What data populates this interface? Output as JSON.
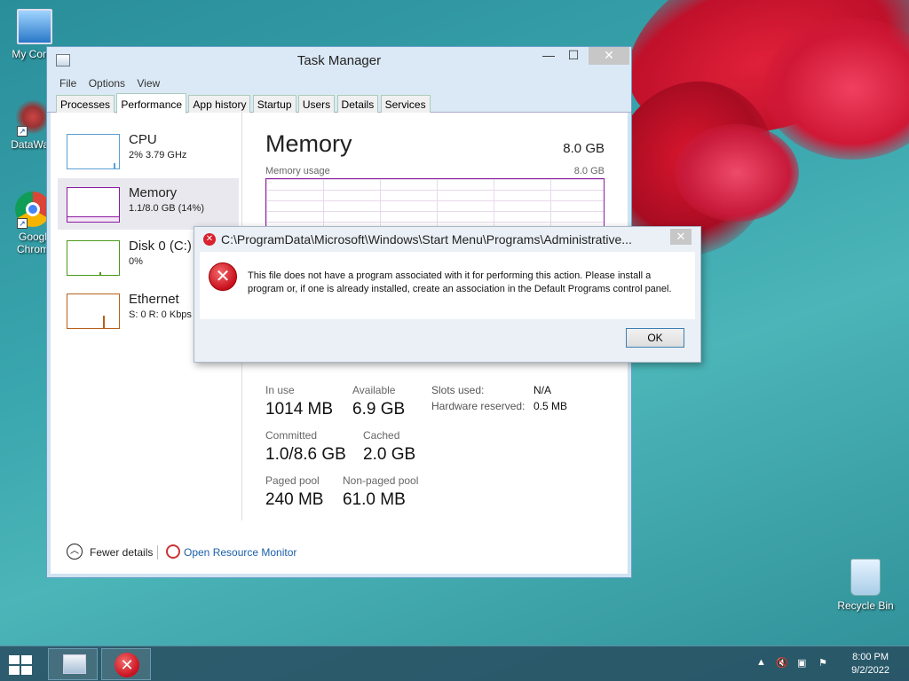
{
  "desktop": {
    "icons": [
      {
        "label": "My Comp"
      },
      {
        "label": "DataWag"
      },
      {
        "label": "Googl Chrom"
      },
      {
        "label": "Recycle Bin"
      }
    ]
  },
  "task_manager": {
    "title": "Task Manager",
    "menu": [
      "File",
      "Options",
      "View"
    ],
    "tabs": [
      "Processes",
      "Performance",
      "App history",
      "Startup",
      "Users",
      "Details",
      "Services"
    ],
    "active_tab": "Performance",
    "sidebar": [
      {
        "name": "CPU",
        "sub": "2%  3.79 GHz"
      },
      {
        "name": "Memory",
        "sub": "1.1/8.0 GB (14%)"
      },
      {
        "name": "Disk 0 (C:)",
        "sub": "0%"
      },
      {
        "name": "Ethernet",
        "sub": "S: 0  R: 0 Kbps"
      }
    ],
    "memory": {
      "title": "Memory",
      "total": "8.0 GB",
      "usage_label": "Memory usage",
      "usage_max": "8.0 GB",
      "stats": {
        "in_use_label": "In use",
        "in_use": "1014 MB",
        "available_label": "Available",
        "available": "6.9 GB",
        "committed_label": "Committed",
        "committed": "1.0/8.6 GB",
        "cached_label": "Cached",
        "cached": "2.0 GB",
        "paged_label": "Paged pool",
        "paged": "240 MB",
        "nonpaged_label": "Non-paged pool",
        "nonpaged": "61.0 MB",
        "slots_label": "Slots used:",
        "slots": "N/A",
        "hw_label": "Hardware reserved:",
        "hw": "0.5 MB"
      }
    },
    "footer": {
      "fewer_details": "Fewer details",
      "open_resource_monitor": "Open Resource Monitor"
    }
  },
  "dialog": {
    "title": "C:\\ProgramData\\Microsoft\\Windows\\Start Menu\\Programs\\Administrative...",
    "message": "This file does not have a program associated with it for performing this action. Please install a program or, if one is already installed, create an association in the Default Programs control panel.",
    "ok_label": "OK"
  },
  "taskbar": {
    "time": "8:00 PM",
    "date": "9/2/2022"
  }
}
